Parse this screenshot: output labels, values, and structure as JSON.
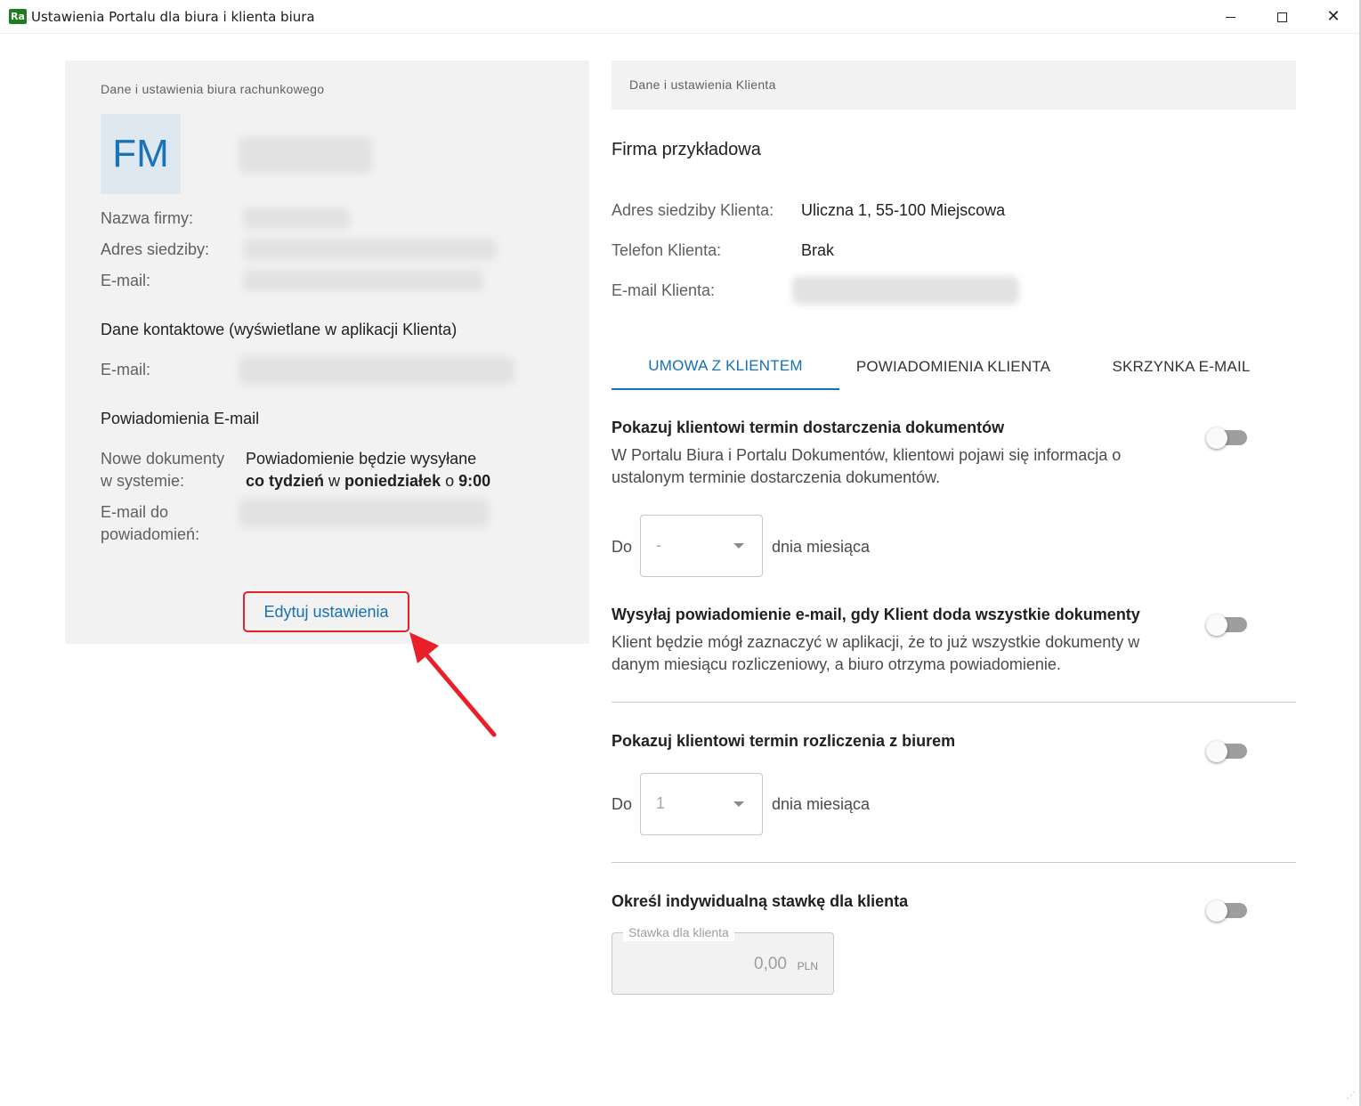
{
  "window": {
    "title": "Ustawienia Portalu dla biura i klienta biura",
    "icon_text": "Ra",
    "close_glyph": "✕"
  },
  "office": {
    "section_label": "Dane i ustawienia biura rachunkowego",
    "avatar_initials": "FM",
    "company_name_label": "Nazwa firmy:",
    "address_label": "Adres siedziby:",
    "email_label": "E-mail:",
    "contact_heading": "Dane kontaktowe (wyświetlane w aplikacji Klienta)",
    "contact_email_label": "E-mail:",
    "notifications_heading": "Powiadomienia E-mail",
    "new_docs_label_1": "Nowe dokumenty",
    "new_docs_label_2": "w systemie:",
    "notif_line1": "Powiadomienie będzie wysyłane",
    "notif_freq": "co tydzień",
    "notif_w": "w",
    "notif_day": "poniedziałek",
    "notif_o": "o",
    "notif_time": "9:00",
    "notif_email_label_1": "E-mail do",
    "notif_email_label_2": "powiadomień:",
    "edit_button": "Edytuj ustawienia"
  },
  "client": {
    "section_label": "Dane i ustawienia Klienta",
    "company_name": "Firma przykładowa",
    "address_label": "Adres siedziby Klienta:",
    "address_value": "Uliczna 1, 55-100 Miejscowa",
    "phone_label": "Telefon Klienta:",
    "phone_value": "Brak",
    "email_label": "E-mail Klienta:"
  },
  "tabs": [
    {
      "label": "UMOWA Z KLIENTEM",
      "active": true
    },
    {
      "label": "POWIADOMIENIA KLIENTA",
      "active": false
    },
    {
      "label": "SKRZYNKA E-MAIL",
      "active": false
    }
  ],
  "options": {
    "doc_deadline": {
      "title": "Pokazuj klientowi termin dostarczenia dokumentów",
      "desc_1": "W Portalu Biura i Portalu Dokumentów, klientowi pojawi się informacja o",
      "desc_2": "ustalonym terminie dostarczenia dokumentów.",
      "enabled": false,
      "do_label": "Do",
      "select_value": "-",
      "suffix": "dnia miesiąca"
    },
    "all_docs_email": {
      "title": "Wysyłaj powiadomienie e-mail, gdy Klient doda wszystkie dokumenty",
      "desc_1": "Klient będzie mógł zaznaczyć w aplikacji, że to już wszystkie dokumenty w",
      "desc_2": "danym miesiącu rozliczeniowy, a biuro otrzyma powiadomienie.",
      "enabled": false
    },
    "settlement_deadline": {
      "title": "Pokazuj klientowi termin rozliczenia z biurem",
      "enabled": false,
      "do_label": "Do",
      "select_value": "1",
      "suffix": "dnia miesiąca"
    },
    "individual_rate": {
      "title": "Określ indywidualną stawkę dla klienta",
      "enabled": false,
      "field_label": "Stawka dla klienta",
      "value": "0,00",
      "unit": "PLN"
    }
  },
  "colors": {
    "accent": "#1670b4",
    "highlight": "#e8202a",
    "panel_bg": "#f2f2f2",
    "toggle_track": "#9e9e9e"
  }
}
